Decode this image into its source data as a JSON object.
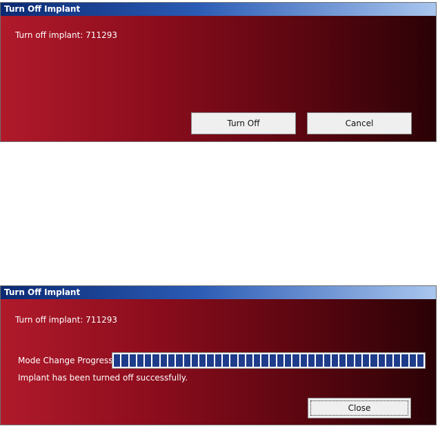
{
  "dialog_top": {
    "title": "Turn Off Implant",
    "message": "Turn off implant: 711293",
    "turn_off_label": "Turn Off",
    "cancel_label": "Cancel"
  },
  "dialog_bottom": {
    "title": "Turn Off Implant",
    "message": "Turn off implant: 711293",
    "progress_label": "Mode Change Progress",
    "progress_fraction": 1.0,
    "status": "Implant has been turned off successfully.",
    "close_label": "Close"
  },
  "colors": {
    "title_start": "#0b2a73",
    "panel_red": "#b01a2b",
    "progress_fill": "#1e3c8a"
  }
}
